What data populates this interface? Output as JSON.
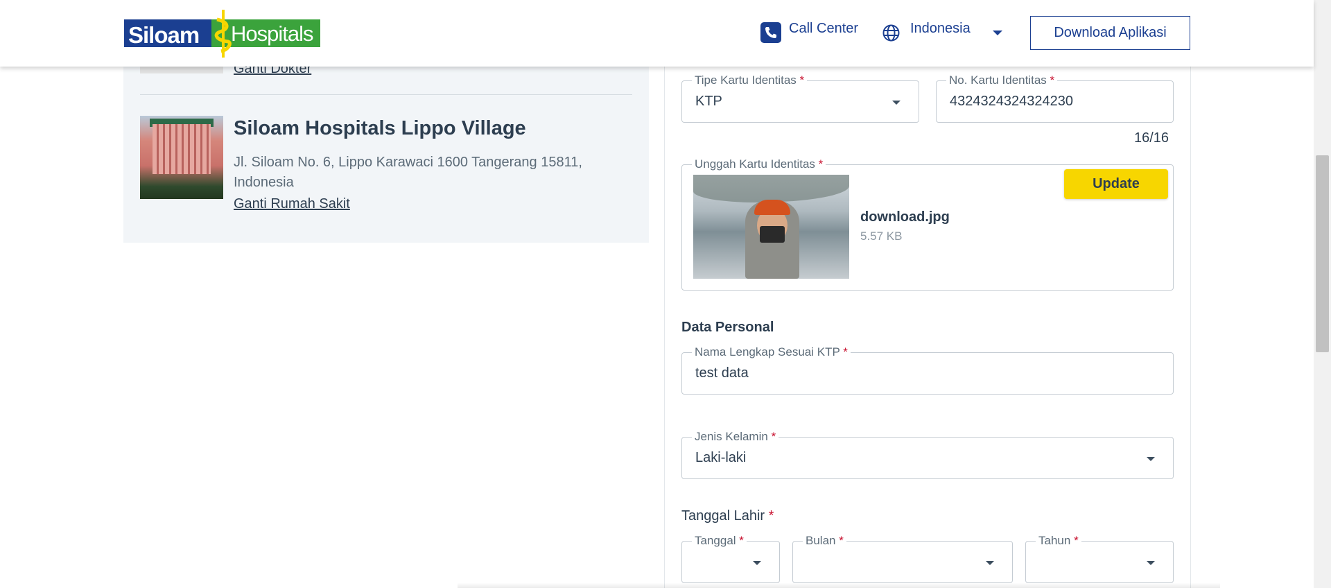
{
  "header": {
    "logo_text_left": "Siloam",
    "logo_text_right": "Hospitals",
    "call_center": "Call Center",
    "language": "Indonesia",
    "download_app": "Download Aplikasi",
    "icons": [
      "phone-icon",
      "globe-icon",
      "caret-down-icon"
    ],
    "colors": {
      "brand_blue": "#1b3f91",
      "brand_green": "#3ba33c",
      "brand_yellow": "#f7d600"
    }
  },
  "left": {
    "doctor_link": "Ganti Dokter",
    "hospital": {
      "name": "Siloam Hospitals Lippo Village",
      "address": "Jl. Siloam No. 6, Lippo Karawaci 1600 Tangerang 15811, Indonesia",
      "change_link": "Ganti Rumah Sakit"
    }
  },
  "form": {
    "id_type": {
      "label": "Tipe Kartu Identitas",
      "value": "KTP"
    },
    "id_number": {
      "label": "No. Kartu Identitas",
      "value": "4324324324324230",
      "counter": "16/16"
    },
    "upload": {
      "label": "Unggah Kartu Identitas",
      "file_name": "download.jpg",
      "file_size": "5.57 KB",
      "button": "Update"
    },
    "personal_section": "Data Personal",
    "full_name": {
      "label": "Nama Lengkap Sesuai KTP",
      "value": "test data"
    },
    "gender": {
      "label": "Jenis Kelamin",
      "value": "Laki-laki"
    },
    "dob": {
      "title": "Tanggal Lahir",
      "day_label": "Tanggal",
      "month_label": "Bulan",
      "year_label": "Tahun"
    },
    "required_mark": "*"
  }
}
